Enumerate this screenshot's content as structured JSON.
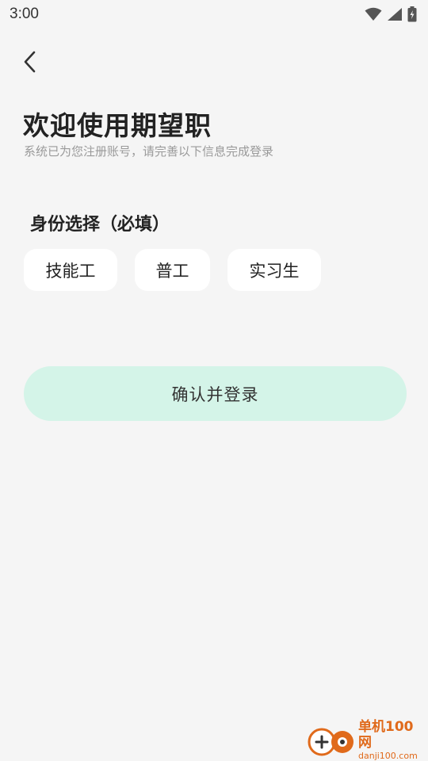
{
  "status_bar": {
    "time": "3:00",
    "icons": [
      "wifi-icon",
      "signal-icon",
      "battery-icon"
    ]
  },
  "header": {
    "back_icon": "chevron-left-icon",
    "title": "欢迎使用期望职",
    "subtitle": "系统已为您注册账号，请完善以下信息完成登录"
  },
  "identity": {
    "label": "身份选择（必填）",
    "options": [
      {
        "label": "技能工"
      },
      {
        "label": "普工"
      },
      {
        "label": "实习生"
      }
    ]
  },
  "confirm": {
    "label": "确认并登录",
    "color": "#d4f4e8"
  },
  "watermark": {
    "title": "单机100网",
    "url": "danji100.com",
    "color": "#e06a1b"
  },
  "colors": {
    "background": "#f5f5f5",
    "chip_background": "#ffffff",
    "subtitle_text": "#9a9a9a"
  }
}
